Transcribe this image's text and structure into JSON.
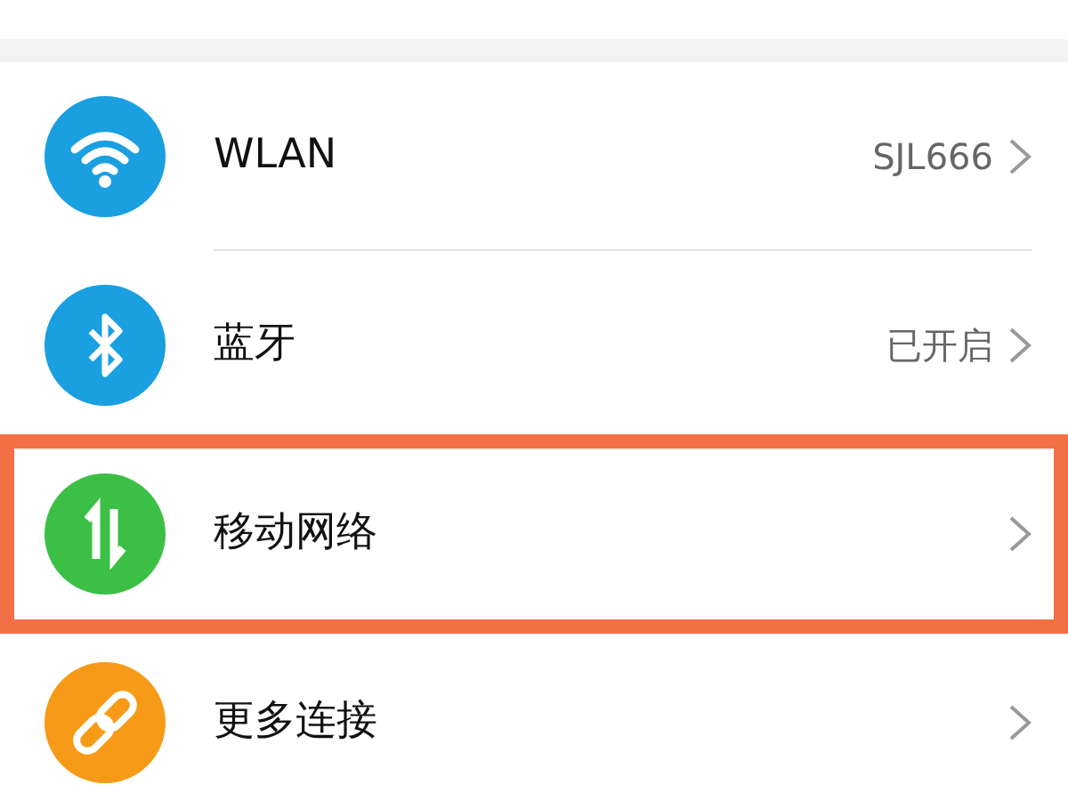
{
  "settings_items": [
    {
      "kind": "wifi",
      "color": "#1a9fe0",
      "label": "WLAN",
      "value": "SJL666",
      "highlighted": false
    },
    {
      "kind": "bluetooth",
      "color": "#1a9fe0",
      "label": "蓝牙",
      "value": "已开启",
      "highlighted": false
    },
    {
      "kind": "data",
      "color": "#3cbf45",
      "label": "移动网络",
      "highlighted": true
    },
    {
      "kind": "link",
      "color": "#f79a17",
      "label": "更多连接",
      "highlighted": false
    }
  ]
}
